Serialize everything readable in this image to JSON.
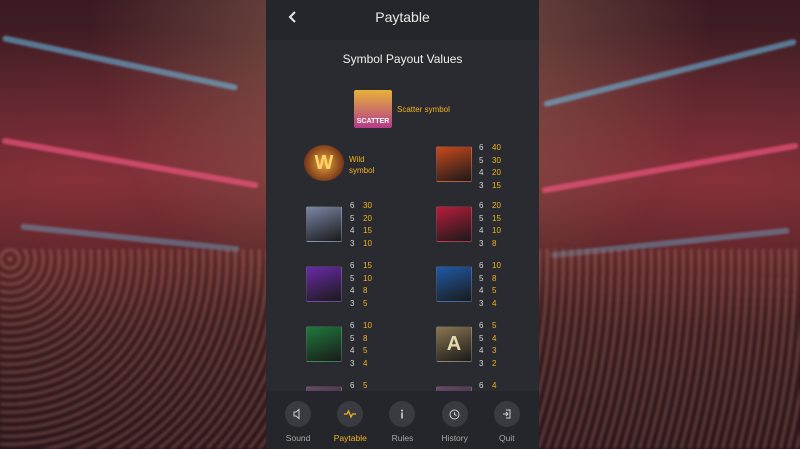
{
  "header": {
    "title": "Paytable",
    "back_icon": "chevron-left-icon"
  },
  "section_title": "Symbol Payout Values",
  "scatter": {
    "label": "SCATTER",
    "description": "Scatter symbol"
  },
  "wild": {
    "label": "W",
    "description_line1": "Wild",
    "description_line2": "symbol"
  },
  "symbols": [
    {
      "name": "fire-wrestler",
      "color": "#c9491c",
      "rows": [
        [
          "6",
          "40"
        ],
        [
          "5",
          "30"
        ],
        [
          "4",
          "20"
        ],
        [
          "3",
          "15"
        ]
      ]
    },
    {
      "name": "masked-wrestler",
      "color": "#7a86a6",
      "rows": [
        [
          "6",
          "30"
        ],
        [
          "5",
          "20"
        ],
        [
          "4",
          "15"
        ],
        [
          "3",
          "10"
        ]
      ]
    },
    {
      "name": "red-mask",
      "color": "#b71c3a",
      "rows": [
        [
          "6",
          "20"
        ],
        [
          "5",
          "15"
        ],
        [
          "4",
          "10"
        ],
        [
          "3",
          "8"
        ]
      ]
    },
    {
      "name": "purple-chair",
      "color": "#6a2aa8",
      "rows": [
        [
          "6",
          "15"
        ],
        [
          "5",
          "10"
        ],
        [
          "4",
          "8"
        ],
        [
          "3",
          "5"
        ]
      ]
    },
    {
      "name": "blue-belt",
      "color": "#1f5aa8",
      "rows": [
        [
          "6",
          "10"
        ],
        [
          "5",
          "8"
        ],
        [
          "4",
          "5"
        ],
        [
          "3",
          "4"
        ]
      ]
    },
    {
      "name": "green-bottle",
      "color": "#1f7a3a",
      "rows": [
        [
          "6",
          "10"
        ],
        [
          "5",
          "8"
        ],
        [
          "4",
          "5"
        ],
        [
          "3",
          "4"
        ]
      ]
    },
    {
      "name": "letter-a",
      "label": "A",
      "color": "#8a7552",
      "rows": [
        [
          "6",
          "5"
        ],
        [
          "5",
          "4"
        ],
        [
          "4",
          "3"
        ],
        [
          "3",
          "2"
        ]
      ]
    },
    {
      "name": "partial-left",
      "color": "#6a4a6a",
      "rows": [
        [
          "6",
          "5"
        ]
      ]
    },
    {
      "name": "partial-right",
      "color": "#6a4a6a",
      "rows": [
        [
          "6",
          "4"
        ]
      ]
    }
  ],
  "footer": {
    "items": [
      {
        "label": "Sound",
        "icon": "speaker-icon"
      },
      {
        "label": "Paytable",
        "icon": "paytable-icon"
      },
      {
        "label": "Rules",
        "icon": "info-icon"
      },
      {
        "label": "History",
        "icon": "history-icon"
      },
      {
        "label": "Quit",
        "icon": "exit-icon"
      }
    ]
  },
  "colors": {
    "accent": "#f2b21f",
    "panel": "#2a2b30",
    "bar": "#25262b"
  }
}
